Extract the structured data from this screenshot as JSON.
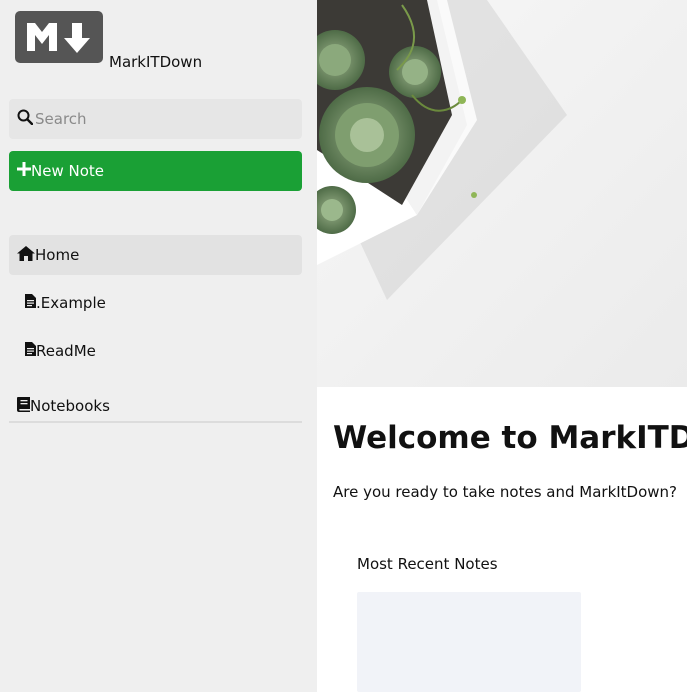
{
  "brand": {
    "logo_text": "M↓",
    "name": "MarkITDown"
  },
  "search": {
    "placeholder": "Search",
    "value": ""
  },
  "actions": {
    "new_note_label": "New Note"
  },
  "nav": {
    "home_label": "Home",
    "notes": [
      {
        "label": ".Example",
        "icon": "file-text-icon"
      },
      {
        "label": "ReadMe",
        "icon": "file-text-icon"
      }
    ],
    "notebooks_label": "Notebooks"
  },
  "main": {
    "hero_image": "succulent-plant-photo",
    "welcome_title": "Welcome to MarkITDown",
    "subtitle": "Are you ready to take notes and MarkItDown?",
    "recent_title": "Most Recent Notes"
  },
  "colors": {
    "sidebar_bg": "#efefef",
    "accent_green": "#1aa035",
    "logo_bg": "#555555",
    "card_bg": "#f1f3f8"
  }
}
